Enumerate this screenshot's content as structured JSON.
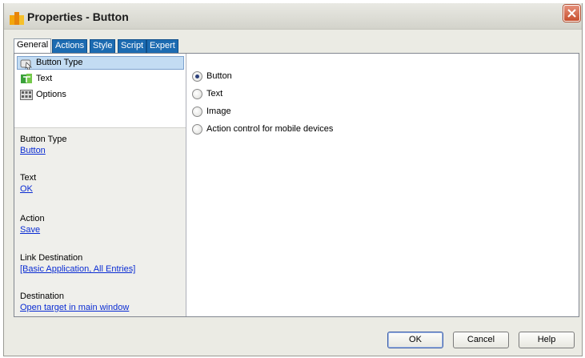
{
  "window": {
    "title": "Properties - Button"
  },
  "tabs": [
    {
      "label": "General",
      "active": true
    },
    {
      "label": "Actions",
      "active": false
    },
    {
      "label": "Style",
      "active": false
    },
    {
      "label": "Script",
      "active": false
    },
    {
      "label": "Expert",
      "active": false
    }
  ],
  "tree": {
    "items": [
      {
        "label": "Button Type",
        "icon": "button-type-icon",
        "selected": true
      },
      {
        "label": "Text",
        "icon": "text-icon",
        "selected": false
      },
      {
        "label": "Options",
        "icon": "options-icon",
        "selected": false
      }
    ]
  },
  "summary": [
    {
      "label": "Button Type",
      "value": "Button"
    },
    {
      "label": "Text",
      "value": "OK"
    },
    {
      "label": "Action",
      "value": "Save"
    },
    {
      "label": "Link Destination",
      "value": "[Basic Application, All Entries]"
    },
    {
      "label": "Destination",
      "value": "Open target in main window"
    }
  ],
  "options": [
    {
      "label": "Button",
      "checked": true
    },
    {
      "label": "Text",
      "checked": false
    },
    {
      "label": "Image",
      "checked": false
    },
    {
      "label": "Action control for mobile devices",
      "checked": false
    }
  ],
  "footer": {
    "ok": "OK",
    "cancel": "Cancel",
    "help": "Help"
  },
  "colors": {
    "tab": "#1c6bb1",
    "link": "#0a2cd3",
    "selection": "#c3dcf3",
    "close": "#c8502e"
  }
}
